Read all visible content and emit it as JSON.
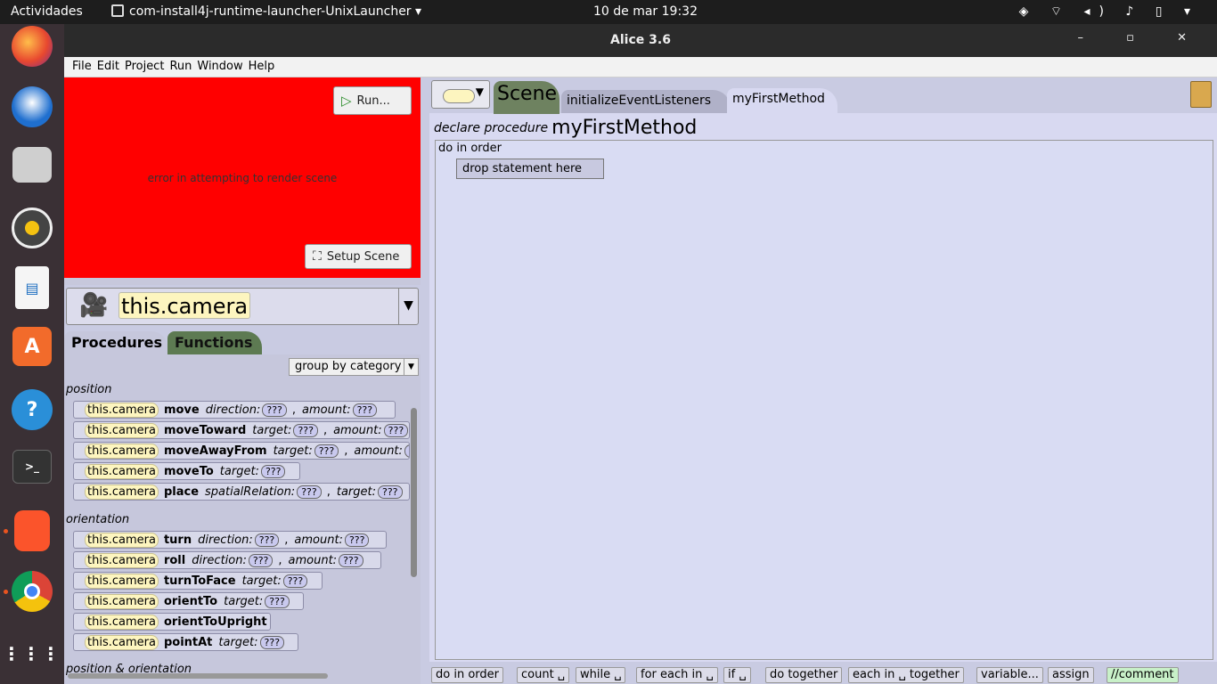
{
  "topbar": {
    "activities": "Actividades",
    "app": "com-install4j-runtime-launcher-UnixLauncher ▾",
    "clock": "10 de mar  19:32",
    "tray": "◈ ⌔ ◂) ♪ ▯ ▾"
  },
  "window": {
    "title": "Alice 3.6",
    "controls": "– ▫ ✕"
  },
  "menu": [
    "File",
    "Edit",
    "Project",
    "Run",
    "Window",
    "Help"
  ],
  "scene": {
    "error": "error in attempting to render scene",
    "run": "Run...",
    "setup": "Setup Scene"
  },
  "camera": {
    "label": "this.camera"
  },
  "tabs": {
    "procedures": "Procedures",
    "functions": "Functions"
  },
  "group": "group by category",
  "categories": {
    "position": "position",
    "orientation": "orientation",
    "posori": "position & orientation"
  },
  "rows": [
    {
      "who": "this.camera",
      "m": "move",
      "p": "direction:",
      "q": "???",
      "p2": "amount:",
      "q2": "???"
    },
    {
      "who": "this.camera",
      "m": "moveToward",
      "p": "target:",
      "q": "???",
      "p2": "amount:",
      "q2": "???"
    },
    {
      "who": "this.camera",
      "m": "moveAwayFrom",
      "p": "target:",
      "q": "???",
      "p2": "amount:",
      "q2": "???"
    },
    {
      "who": "this.camera",
      "m": "moveTo",
      "p": "target:",
      "q": "???"
    },
    {
      "who": "this.camera",
      "m": "place",
      "p": "spatialRelation:",
      "q": "???",
      "p2": "target:",
      "q2": "???"
    },
    {
      "who": "this.camera",
      "m": "turn",
      "p": "direction:",
      "q": "???",
      "p2": "amount:",
      "q2": "???"
    },
    {
      "who": "this.camera",
      "m": "roll",
      "p": "direction:",
      "q": "???",
      "p2": "amount:",
      "q2": "???"
    },
    {
      "who": "this.camera",
      "m": "turnToFace",
      "p": "target:",
      "q": "???"
    },
    {
      "who": "this.camera",
      "m": "orientTo",
      "p": "target:",
      "q": "???"
    },
    {
      "who": "this.camera",
      "m": "orientToUpright"
    },
    {
      "who": "this.camera",
      "m": "pointAt",
      "p": "target:",
      "q": "???"
    }
  ],
  "editor": {
    "scene_tab": "Scene",
    "tab1": "initializeEventListeners",
    "tab2": "myFirstMethod",
    "declare": "declare procedure",
    "method": "myFirstMethod",
    "do_in_order": "do in order",
    "drop": "drop statement here"
  },
  "palette": [
    "do in order",
    "count ␣",
    "while ␣",
    "for each in ␣",
    "if ␣",
    "do together",
    "each in ␣ together",
    "variable...",
    "assign",
    "//comment"
  ]
}
